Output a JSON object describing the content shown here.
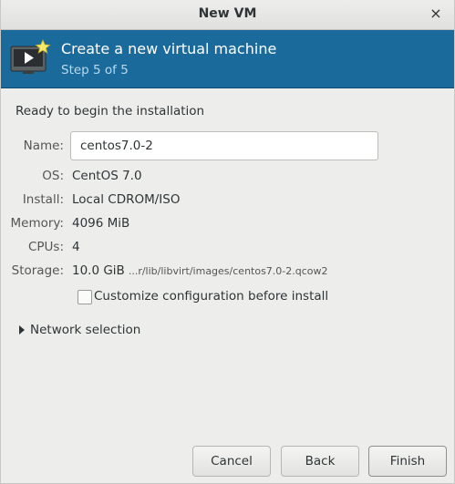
{
  "window": {
    "title": "New VM",
    "close_glyph": "×"
  },
  "banner": {
    "title": "Create a new virtual machine",
    "subtitle": "Step 5 of 5",
    "icon": "vm-monitor-star-icon",
    "color": "#1b6a9c"
  },
  "summary": {
    "heading": "Ready to begin the installation",
    "name_label": "Name:",
    "name_value": "centos7.0-2",
    "os_label": "OS:",
    "os_value": "CentOS 7.0",
    "install_label": "Install:",
    "install_value": "Local CDROM/ISO",
    "memory_label": "Memory:",
    "memory_value": "4096 MiB",
    "cpus_label": "CPUs:",
    "cpus_value": "4",
    "storage_label": "Storage:",
    "storage_value": "10.0 GiB",
    "storage_path": "...r/lib/libvirt/images/centos7.0-2.qcow2"
  },
  "options": {
    "customize_label": "Customize configuration before install",
    "customize_checked": false,
    "network_label": "Network selection"
  },
  "buttons": {
    "cancel": "Cancel",
    "back": "Back",
    "finish": "Finish"
  }
}
